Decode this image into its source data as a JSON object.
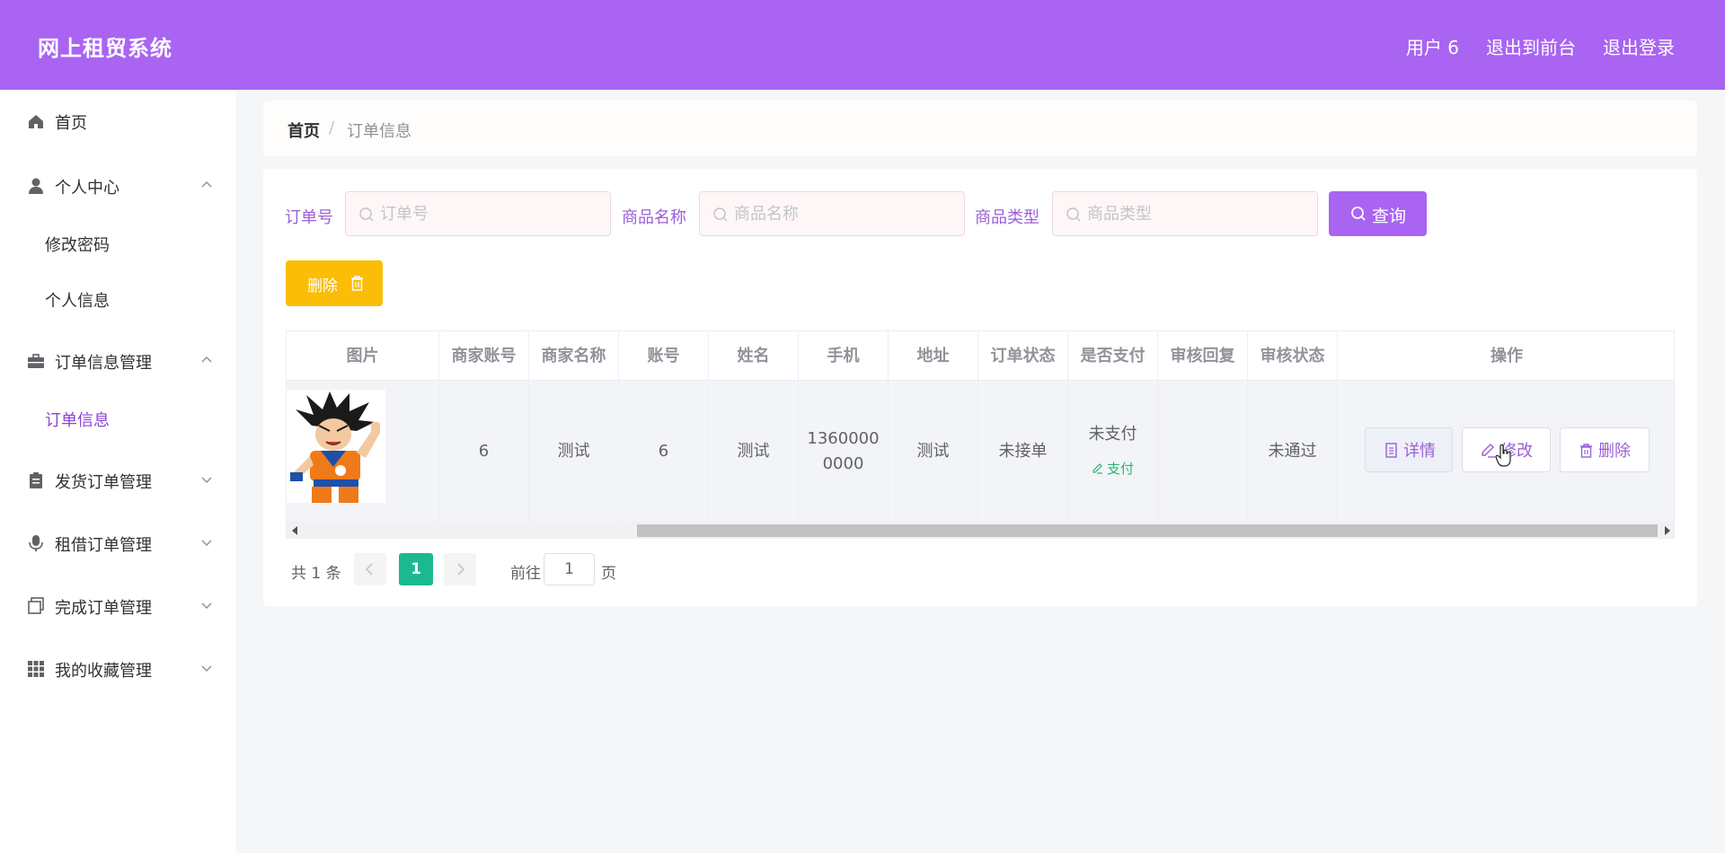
{
  "header": {
    "title": "网上租贸系统",
    "user": "用户 6",
    "back_to_front": "退出到前台",
    "logout": "退出登录",
    "color": "#a964f2"
  },
  "sidebar": {
    "items": [
      {
        "label": "首页",
        "icon": "home-icon"
      },
      {
        "label": "个人中心",
        "icon": "user-icon",
        "expanded": true,
        "children": [
          "修改密码",
          "个人信息"
        ]
      },
      {
        "label": "订单信息管理",
        "icon": "briefcase-icon",
        "expanded": true,
        "children": [
          "订单信息"
        ]
      },
      {
        "label": "发货订单管理",
        "icon": "clipboard-icon",
        "expanded": false
      },
      {
        "label": "租借订单管理",
        "icon": "microphone-icon",
        "expanded": false
      },
      {
        "label": "完成订单管理",
        "icon": "copy-icon",
        "expanded": false
      },
      {
        "label": "我的收藏管理",
        "icon": "grid-icon",
        "expanded": false
      }
    ],
    "active_child": "订单信息"
  },
  "breadcrumb": {
    "home": "首页",
    "separator": "/",
    "current": "订单信息"
  },
  "filters": {
    "order_no_label": "订单号",
    "order_no_placeholder": "订单号",
    "product_name_label": "商品名称",
    "product_name_placeholder": "商品名称",
    "product_type_label": "商品类型",
    "product_type_placeholder": "商品类型",
    "query_button": "查询"
  },
  "actions": {
    "delete_button": "删除"
  },
  "table": {
    "columns": [
      "图片",
      "商家账号",
      "商家名称",
      "账号",
      "姓名",
      "手机",
      "地址",
      "订单状态",
      "是否支付",
      "审核回复",
      "审核状态",
      "操作"
    ],
    "rows": [
      {
        "merchant_account": "6",
        "merchant_name": "测试",
        "account": "6",
        "name": "测试",
        "phone_line1": "1360000",
        "phone_line2": "0000",
        "address": "测试",
        "order_status": "未接单",
        "paid": "未支付",
        "pay_link": "支付",
        "review_reply": "",
        "review_status": "未通过",
        "ops": {
          "detail": "详情",
          "edit": "修改",
          "delete": "删除"
        }
      }
    ]
  },
  "pagination": {
    "total": "共 1 条",
    "current_page": "1",
    "goto_label": "前往",
    "goto_value": "1",
    "page_unit": "页"
  }
}
